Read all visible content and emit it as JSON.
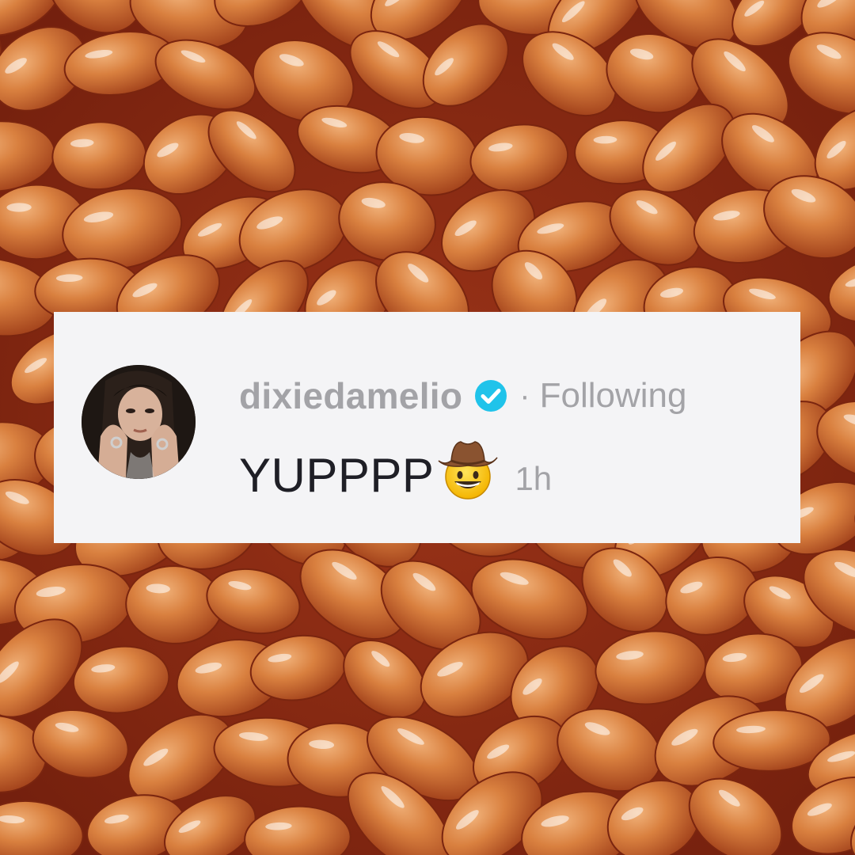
{
  "background": {
    "icon": "baked-beans-photo",
    "sauce_color": "#8a2a14",
    "bean_color": "#d9803f"
  },
  "comment": {
    "username": "dixiedamelio",
    "verified_icon": "verified-check-icon",
    "separator": "·",
    "follow_status": "Following",
    "text": "YUPPPP",
    "emoji_icon": "cowboy-hat-face-emoji",
    "timestamp": "1h",
    "avatar_icon": "profile-photo"
  },
  "colors": {
    "card_bg": "#f4f4f6",
    "muted_text": "#a3a3a7",
    "comment_text": "#1f1f26",
    "verified_blue": "#20c3ea"
  }
}
